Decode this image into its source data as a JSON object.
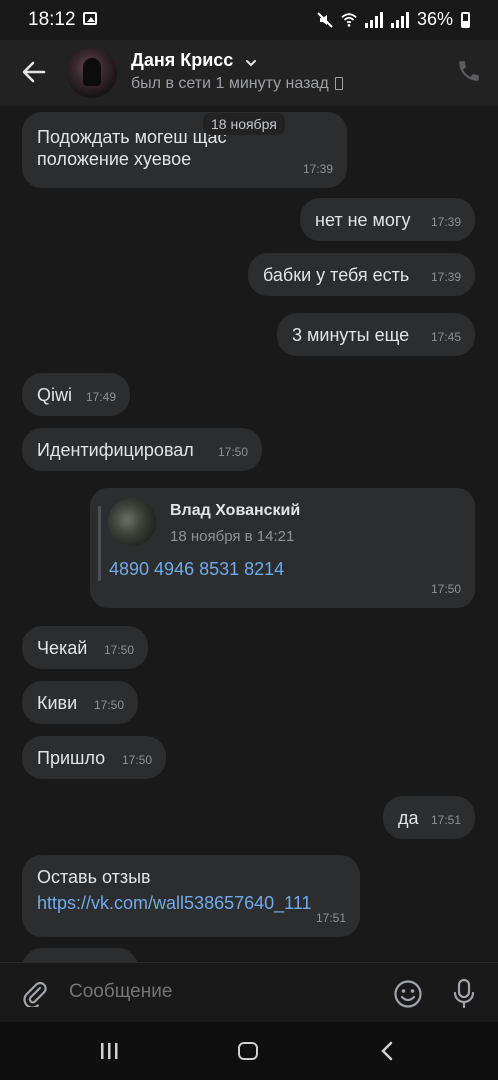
{
  "status_bar": {
    "time": "18:12",
    "battery": "36%"
  },
  "header": {
    "name": "Даня Крисс",
    "status": "был в сети 1 минуту назад"
  },
  "date_separator": "18 ноября",
  "messages": [
    {
      "text": "Подождать могеш       щас\nположение хуевое",
      "time": "17:39",
      "side": "in"
    },
    {
      "text": "нет не могу",
      "time": "17:39",
      "side": "out"
    },
    {
      "text": "бабки у тебя есть",
      "time": "17:39",
      "side": "out"
    },
    {
      "text": "3 минуты еще",
      "time": "17:45",
      "side": "out"
    },
    {
      "text": "Qiwi",
      "time": "17:49",
      "side": "in"
    },
    {
      "text": "Идентифицировал",
      "time": "17:50",
      "side": "in"
    },
    {
      "text": "Чекай",
      "time": "17:50",
      "side": "in"
    },
    {
      "text": "Киви",
      "time": "17:50",
      "side": "in"
    },
    {
      "text": "Пришло",
      "time": "17:50",
      "side": "in"
    },
    {
      "text": "да",
      "time": "17:51",
      "side": "out"
    }
  ],
  "forward": {
    "author": "Влад Хованский",
    "date": "18 ноября в 14:21",
    "text": "4890 4946 8531 8214",
    "time": "17:50"
  },
  "review_message": {
    "text": "Оставь отзыв",
    "link": "https://vk.com/wall538657640_111",
    "time": "17:51"
  },
  "composer": {
    "placeholder": "Сообщение"
  },
  "colors": {
    "background": "#19191a",
    "bubble": "#2c2d2e",
    "link": "#71aaeb"
  }
}
